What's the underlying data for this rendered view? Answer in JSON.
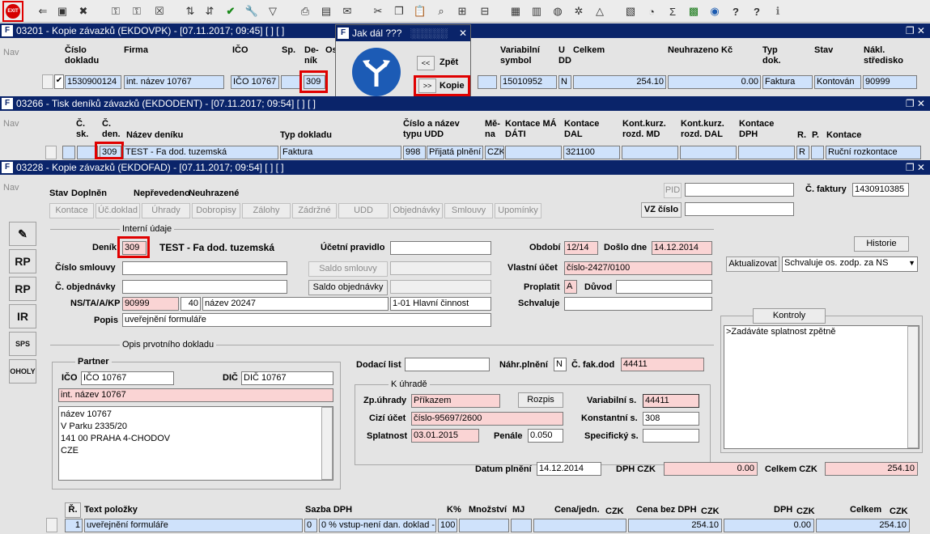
{
  "toolbar": {
    "exit_label": "EXIT"
  },
  "win1": {
    "title": "03201 - Kopie závazků (EKDOVPK) - [07.11.2017; 09:45] [ ] [ ]",
    "nav": "Nav",
    "cols": {
      "cislo": "Číslo dokladu",
      "firma": "Firma",
      "ico": "IČO",
      "sp": "Sp.",
      "denik": "De-ník",
      "os": "Os",
      "vs": "Variabilní symbol",
      "udd": "U DD",
      "celkem": "Celkem",
      "neuhrazeno": "Neuhrazeno Kč",
      "typ": "Typ dok.",
      "stav": "Stav",
      "naklad": "Nákl. středisko"
    },
    "row": {
      "cislo": "1530900124",
      "firma": "int. název 10767",
      "ico": "IČO 10767",
      "denik": "309",
      "vs": "15010952",
      "udd": "N",
      "celkem": "254.10",
      "neuhrazeno": "0.00",
      "typ": "Faktura",
      "stav": "Kontován",
      "naklad": "90999"
    }
  },
  "dialog": {
    "title": "Jak dál ???",
    "back": "Zpět",
    "copy": "Kopie",
    "back_icon": "<<",
    "copy_icon": ">>"
  },
  "win2": {
    "title": "03266 - Tisk deníků závazků (EKDODENT) - [07.11.2017; 09:54] [ ] [ ]",
    "nav": "Nav",
    "cols": {
      "csk": "Č. sk.",
      "cden": "Č. den.",
      "nazev": "Název deníku",
      "typ": "Typ dokladu",
      "cislo": "Číslo a název typu UDD",
      "mena": "Mě-na",
      "md": "Kontace MÁ DÁTI",
      "dal": "Kontace DAL",
      "kkmd": "Kont.kurz. rozd. MD",
      "kkdal": "Kont.kurz. rozd. DAL",
      "dph": "Kontace DPH",
      "r": "R.",
      "p": "P.",
      "kontace": "Kontace"
    },
    "row": {
      "cden": "309",
      "nazev": "TEST - Fa dod. tuzemská",
      "typ": "Faktura",
      "cislo": "998",
      "udd": "Přijatá plnění z",
      "mena": "CZK",
      "dal": "321100",
      "r": "R",
      "kontace": "Ruční rozkontace"
    }
  },
  "win3": {
    "title": "03228 - Kopie závazků (EKDOFAD) - [07.11.2017; 09:54] [ ] [ ]",
    "nav": "Nav",
    "stav_label": "Stav",
    "stav1": "Doplněn",
    "stav2": "Nepřevedeno",
    "stav3": "Neuhrazené",
    "tabs": [
      "Kontace",
      "Úč.doklad",
      "Úhrady",
      "Dobropisy",
      "Zálohy",
      "Zádržné",
      "UDD",
      "Objednávky",
      "Smlouvy",
      "Upomínky"
    ],
    "pid": "PID",
    "vz": "VZ číslo",
    "c_faktury_label": "Č. faktury",
    "c_faktury": "1430910385",
    "interni": "Interní údaje",
    "denik_label": "Deník",
    "denik": "309",
    "denik_name": "TEST - Fa dod. tuzemská",
    "ucetni_label": "Účetní pravidlo",
    "obdobi_label": "Období",
    "obdobi": "12/14",
    "doslo_label": "Došlo dne",
    "doslo": "14.12.2014",
    "historie": "Historie",
    "smlouva_label": "Číslo smlouvy",
    "saldo_smlouvy": "Saldo smlouvy",
    "vlastni_label": "Vlastní účet",
    "vlastni": "číslo-2427/0100",
    "aktualizovat": "Aktualizovat",
    "schvaluje_sel": "Schvaluje os. zodp. za NS",
    "objednavka_label": "Č. objednávky",
    "saldo_obj": "Saldo objednávky",
    "proplatit_label": "Proplatit",
    "proplatit": "A",
    "duvod_label": "Důvod",
    "ns_label": "NS/TA/A/KP",
    "ns": "90999",
    "ta": "40",
    "a": "název 20247",
    "kp": "1-01 Hlavní činnost",
    "schvaluje_label": "Schvaluje",
    "popis_label": "Popis",
    "popis": "uveřejnění formuláře",
    "kontroly": "Kontroly",
    "kontroly_text": ">Zadáváte splatnost zpětně",
    "opis": "Opis prvotního dokladu",
    "partner": "Partner",
    "ico_label": "IČO",
    "ico": "IČO 10767",
    "dic_label": "DIČ",
    "dic": "DIČ 10767",
    "int_nazev": "int. název 10767",
    "adresa": [
      "název 10767",
      "V Parku 2335/20",
      "141 00 PRAHA 4-CHODOV",
      "CZE"
    ],
    "dodaci_label": "Dodací list",
    "nahr_label": "Náhr.plnění",
    "nahr": "N",
    "cfak_label": "Č. fak.dod",
    "cfak": "44411",
    "k_uhrade": "K úhradě",
    "zp_label": "Zp.úhrady",
    "zp": "Příkazem",
    "rozpis": "Rozpis",
    "vs_label": "Variabilní s.",
    "vs": "44411",
    "cizi_label": "Cizí účet",
    "cizi": "číslo-95697/2600",
    "ks_label": "Konstantní s.",
    "ks": "308",
    "splatnost_label": "Splatnost",
    "splatnost": "03.01.2015",
    "penale_label": "Penále",
    "penale": "0.050",
    "ss_label": "Specifický s.",
    "datum_label": "Datum plnění",
    "datum": "14.12.2014",
    "dph_label": "DPH CZK",
    "dph": "0.00",
    "celkem_label": "Celkem CZK",
    "celkem": "254.10"
  },
  "items": {
    "cols": {
      "r": "Ř.",
      "text": "Text položky",
      "sazba": "Sazba DPH",
      "kp": "K%",
      "mn": "Množství",
      "mj": "MJ",
      "cj": "Cena/jedn.",
      "cj_cur": "CZK",
      "cbd": "Cena bez DPH",
      "cbd_cur": "CZK",
      "dph": "DPH",
      "dph_cur": "CZK",
      "celk": "Celkem",
      "celk_cur": "CZK"
    },
    "row": {
      "r": "1",
      "text": "uveřejnění formuláře",
      "sazba": "0",
      "sazba_txt": "0 % vstup-není dan. doklad -",
      "kp": "100",
      "cbd": "254.10",
      "dph": "0.00",
      "celk": "254.10"
    }
  }
}
